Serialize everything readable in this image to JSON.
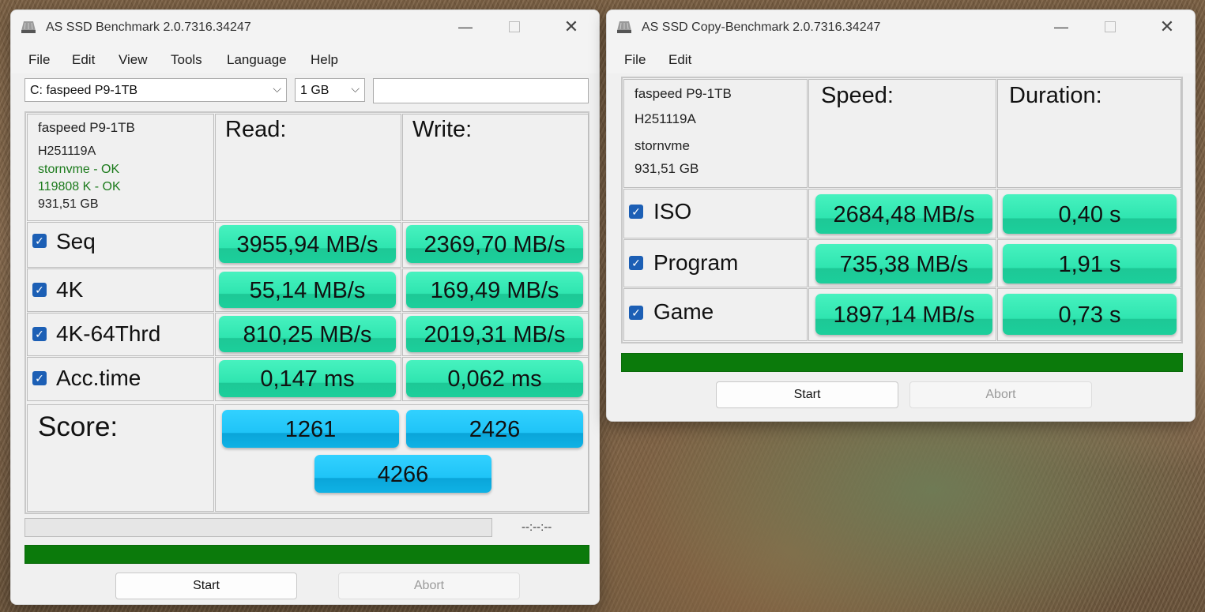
{
  "main": {
    "title": "AS SSD Benchmark 2.0.7316.34247",
    "menu": [
      "File",
      "Edit",
      "View",
      "Tools",
      "Language",
      "Help"
    ],
    "drive_select": "C: faspeed P9-1TB",
    "size_select": "1 GB",
    "drive_info": [
      "faspeed P9-1TB",
      "H251119A",
      "stornvme - OK",
      "119808 K - OK",
      "931,51 GB"
    ],
    "read_header": "Read:",
    "write_header": "Write:",
    "rows": [
      {
        "label": "Seq",
        "read": "3955,94 MB/s",
        "write": "2369,70 MB/s"
      },
      {
        "label": "4K",
        "read": "55,14 MB/s",
        "write": "169,49 MB/s"
      },
      {
        "label": "4K-64Thrd",
        "read": "810,25 MB/s",
        "write": "2019,31 MB/s"
      },
      {
        "label": "Acc.time",
        "read": "0,147 ms",
        "write": "0,062 ms"
      }
    ],
    "score_label": "Score:",
    "score_read": "1261",
    "score_write": "2426",
    "score_total": "4266",
    "timer": "--:--:--",
    "progress": 1.0,
    "start_label": "Start",
    "abort_label": "Abort"
  },
  "copy": {
    "title": "AS SSD Copy-Benchmark 2.0.7316.34247",
    "menu": [
      "File",
      "Edit"
    ],
    "drive_info": [
      "faspeed P9-1TB",
      "H251119A",
      "stornvme",
      "931,51 GB"
    ],
    "speed_header": "Speed:",
    "duration_header": "Duration:",
    "rows": [
      {
        "label": "ISO",
        "speed": "2684,48 MB/s",
        "duration": "0,40 s"
      },
      {
        "label": "Program",
        "speed": "735,38 MB/s",
        "duration": "1,91 s"
      },
      {
        "label": "Game",
        "speed": "1897,14 MB/s",
        "duration": "0,73 s"
      }
    ],
    "progress": 1.0,
    "start_label": "Start",
    "abort_label": "Abort"
  },
  "icons": {
    "app": "drive-icon",
    "minimize": "minimize-icon",
    "maximize": "maximize-icon",
    "close": "close-icon",
    "checkbox": "checkbox-checked-icon",
    "dropdown": "chevron-down-icon"
  },
  "colors": {
    "result_green": "#2fe5b0",
    "score_blue": "#1fc4f7",
    "progress_green": "#0b7a0b",
    "status_ok": "#1b7a1b"
  }
}
